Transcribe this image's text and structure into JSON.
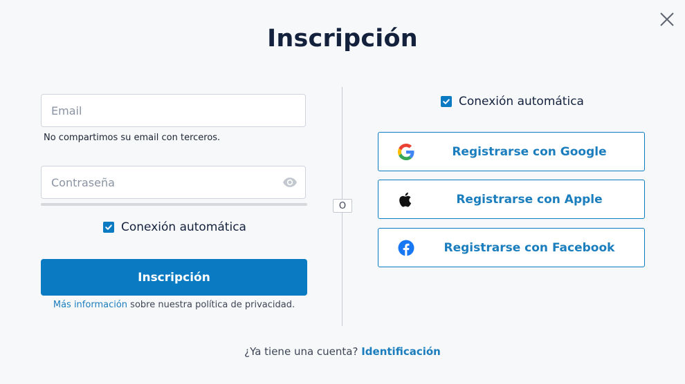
{
  "dialog": {
    "title": "Inscripción",
    "close_icon": "close-icon"
  },
  "form": {
    "email": {
      "placeholder": "Email",
      "value": "",
      "helper": "No compartimos su email con terceros."
    },
    "password": {
      "placeholder": "Contraseña",
      "value": "",
      "toggle_icon": "eye-icon",
      "strength_fraction": 0
    },
    "auto_connect": {
      "label": "Conexión automática",
      "checked": true
    },
    "submit_label": "Inscripción",
    "privacy": {
      "link": "Más información",
      "text": "sobre nuestra política de privacidad."
    }
  },
  "separator": {
    "label": "O"
  },
  "social": {
    "auto_connect": {
      "label": "Conexión automática",
      "checked": true
    },
    "buttons": [
      {
        "label": "Registrarse con Google",
        "icon": "google-icon"
      },
      {
        "label": "Registrarse con Apple",
        "icon": "apple-icon"
      },
      {
        "label": "Registrarse con Facebook",
        "icon": "facebook-icon"
      }
    ]
  },
  "footer": {
    "question": "¿Ya tiene una cuenta?",
    "link": "Identificación"
  },
  "colors": {
    "background": "#f7f8fa",
    "accent": "#0a7bc2",
    "link": "#1a7dbd",
    "heading": "#14213d",
    "facebook": "#1877f2"
  }
}
